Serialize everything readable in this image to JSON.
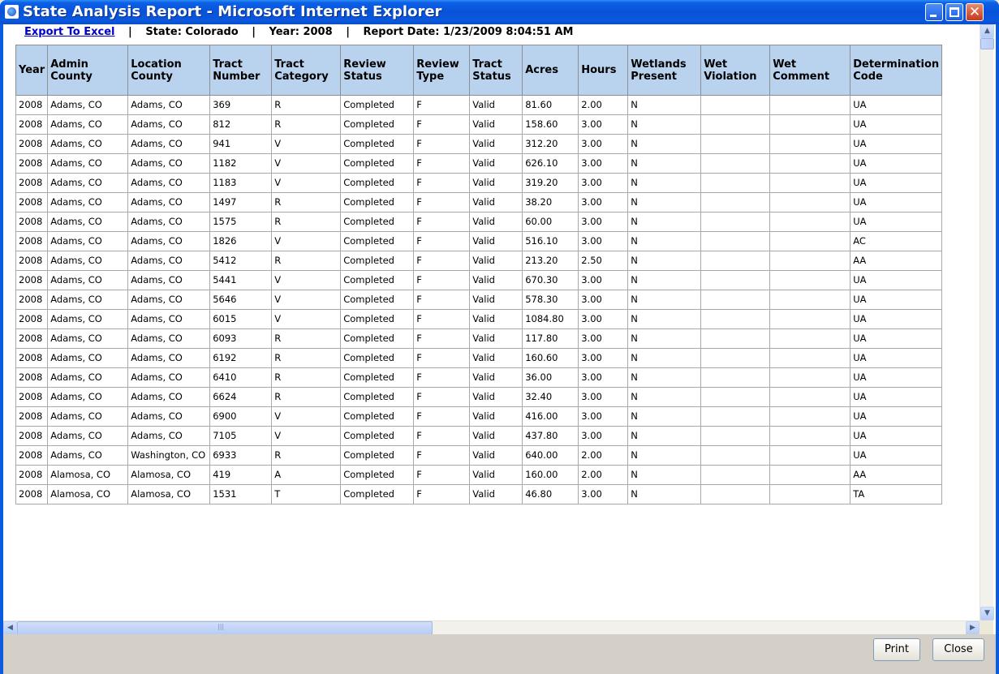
{
  "window": {
    "title": "State Analysis Report - Microsoft Internet Explorer"
  },
  "infobar": {
    "export_link": "Export To Excel",
    "separator": "|",
    "state": "State: Colorado",
    "year": "Year: 2008",
    "report_date": "Report Date: 1/23/2009 8:04:51 AM"
  },
  "table": {
    "columns": [
      "Year",
      "Admin County",
      "Location County",
      "Tract Number",
      "Tract Category",
      "Review Status",
      "Review Type",
      "Tract Status",
      "Acres",
      "Hours",
      "Wetlands Present",
      "Wet Violation",
      "Wet Comment",
      "Determination Code"
    ],
    "rows": [
      [
        "2008",
        "Adams, CO",
        "Adams, CO",
        "369",
        "R",
        "Completed",
        "F",
        "Valid",
        "81.60",
        "2.00",
        "N",
        "",
        "",
        "UA"
      ],
      [
        "2008",
        "Adams, CO",
        "Adams, CO",
        "812",
        "R",
        "Completed",
        "F",
        "Valid",
        "158.60",
        "3.00",
        "N",
        "",
        "",
        "UA"
      ],
      [
        "2008",
        "Adams, CO",
        "Adams, CO",
        "941",
        "V",
        "Completed",
        "F",
        "Valid",
        "312.20",
        "3.00",
        "N",
        "",
        "",
        "UA"
      ],
      [
        "2008",
        "Adams, CO",
        "Adams, CO",
        "1182",
        "V",
        "Completed",
        "F",
        "Valid",
        "626.10",
        "3.00",
        "N",
        "",
        "",
        "UA"
      ],
      [
        "2008",
        "Adams, CO",
        "Adams, CO",
        "1183",
        "V",
        "Completed",
        "F",
        "Valid",
        "319.20",
        "3.00",
        "N",
        "",
        "",
        "UA"
      ],
      [
        "2008",
        "Adams, CO",
        "Adams, CO",
        "1497",
        "R",
        "Completed",
        "F",
        "Valid",
        "38.20",
        "3.00",
        "N",
        "",
        "",
        "UA"
      ],
      [
        "2008",
        "Adams, CO",
        "Adams, CO",
        "1575",
        "R",
        "Completed",
        "F",
        "Valid",
        "60.00",
        "3.00",
        "N",
        "",
        "",
        "UA"
      ],
      [
        "2008",
        "Adams, CO",
        "Adams, CO",
        "1826",
        "V",
        "Completed",
        "F",
        "Valid",
        "516.10",
        "3.00",
        "N",
        "",
        "",
        "AC"
      ],
      [
        "2008",
        "Adams, CO",
        "Adams, CO",
        "5412",
        "R",
        "Completed",
        "F",
        "Valid",
        "213.20",
        "2.50",
        "N",
        "",
        "",
        "AA"
      ],
      [
        "2008",
        "Adams, CO",
        "Adams, CO",
        "5441",
        "V",
        "Completed",
        "F",
        "Valid",
        "670.30",
        "3.00",
        "N",
        "",
        "",
        "UA"
      ],
      [
        "2008",
        "Adams, CO",
        "Adams, CO",
        "5646",
        "V",
        "Completed",
        "F",
        "Valid",
        "578.30",
        "3.00",
        "N",
        "",
        "",
        "UA"
      ],
      [
        "2008",
        "Adams, CO",
        "Adams, CO",
        "6015",
        "V",
        "Completed",
        "F",
        "Valid",
        "1084.80",
        "3.00",
        "N",
        "",
        "",
        "UA"
      ],
      [
        "2008",
        "Adams, CO",
        "Adams, CO",
        "6093",
        "R",
        "Completed",
        "F",
        "Valid",
        "117.80",
        "3.00",
        "N",
        "",
        "",
        "UA"
      ],
      [
        "2008",
        "Adams, CO",
        "Adams, CO",
        "6192",
        "R",
        "Completed",
        "F",
        "Valid",
        "160.60",
        "3.00",
        "N",
        "",
        "",
        "UA"
      ],
      [
        "2008",
        "Adams, CO",
        "Adams, CO",
        "6410",
        "R",
        "Completed",
        "F",
        "Valid",
        "36.00",
        "3.00",
        "N",
        "",
        "",
        "UA"
      ],
      [
        "2008",
        "Adams, CO",
        "Adams, CO",
        "6624",
        "R",
        "Completed",
        "F",
        "Valid",
        "32.40",
        "3.00",
        "N",
        "",
        "",
        "UA"
      ],
      [
        "2008",
        "Adams, CO",
        "Adams, CO",
        "6900",
        "V",
        "Completed",
        "F",
        "Valid",
        "416.00",
        "3.00",
        "N",
        "",
        "",
        "UA"
      ],
      [
        "2008",
        "Adams, CO",
        "Adams, CO",
        "7105",
        "V",
        "Completed",
        "F",
        "Valid",
        "437.80",
        "3.00",
        "N",
        "",
        "",
        "UA"
      ],
      [
        "2008",
        "Adams, CO",
        "Washington, CO",
        "6933",
        "R",
        "Completed",
        "F",
        "Valid",
        "640.00",
        "2.00",
        "N",
        "",
        "",
        "UA"
      ],
      [
        "2008",
        "Alamosa, CO",
        "Alamosa, CO",
        "419",
        "A",
        "Completed",
        "F",
        "Valid",
        "160.00",
        "2.00",
        "N",
        "",
        "",
        "AA"
      ],
      [
        "2008",
        "Alamosa, CO",
        "Alamosa, CO",
        "1531",
        "T",
        "Completed",
        "F",
        "Valid",
        "46.80",
        "3.00",
        "N",
        "",
        "",
        "TA"
      ]
    ]
  },
  "buttons": {
    "print": "Print",
    "close": "Close"
  },
  "colors": {
    "header_bg": "#B9D3EE",
    "titlebar": "#0A58DE",
    "link": "#0000CC"
  },
  "icons": {
    "window_icon": "ie-page-icon",
    "minimize": "minimize-icon",
    "maximize": "maximize-icon",
    "close": "close-icon"
  }
}
